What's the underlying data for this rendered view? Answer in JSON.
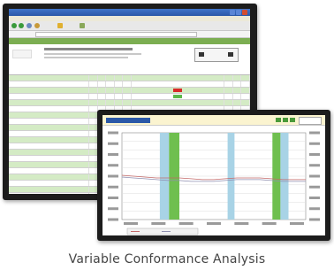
{
  "caption": "Variable Conformance Analysis",
  "colors": {
    "accent_green": "#7cae52",
    "row_green": "#d4ebc5",
    "band_blue": "#a8d3e6",
    "band_green": "#6fbf4f",
    "chart_line": "#c46a6a",
    "title_bar": "#2b58a8"
  },
  "icons": [
    "minimize-icon",
    "maximize-icon",
    "close-icon",
    "back-icon",
    "forward-icon",
    "refresh-icon",
    "home-icon"
  ],
  "chart_data": {
    "type": "line",
    "x": [
      0,
      1,
      2,
      3,
      4,
      5,
      6,
      7,
      8,
      9,
      10,
      11,
      12,
      13,
      14,
      15,
      16
    ],
    "series": [
      {
        "values": [
          51,
          50,
          49,
          48,
          48,
          48,
          47,
          46,
          46,
          47,
          48,
          48,
          48,
          47,
          46,
          46,
          46
        ]
      },
      {
        "values": [
          49,
          48,
          47,
          46,
          45,
          45,
          44,
          44,
          44,
          45,
          46,
          46,
          46,
          45,
          44,
          44,
          44
        ]
      }
    ],
    "bands": [
      {
        "from": 3.3,
        "to": 4.1,
        "color": "#a8d3e6"
      },
      {
        "from": 4.1,
        "to": 5.0,
        "color": "#6fbf4f"
      },
      {
        "from": 9.2,
        "to": 9.8,
        "color": "#a8d3e6"
      },
      {
        "from": 13.1,
        "to": 13.8,
        "color": "#6fbf4f"
      },
      {
        "from": 13.8,
        "to": 14.5,
        "color": "#a8d3e6"
      }
    ],
    "ylim": [
      0,
      100
    ],
    "xlim": [
      0,
      16
    ],
    "grid": true,
    "legend": "bottom-left"
  }
}
